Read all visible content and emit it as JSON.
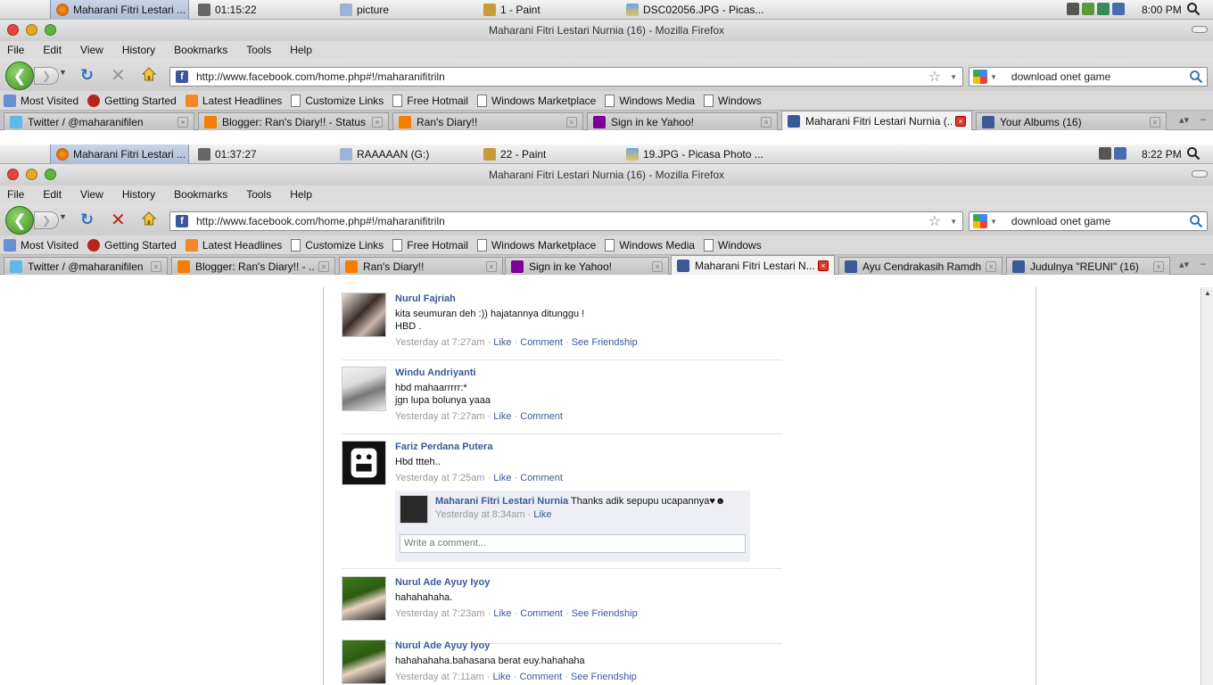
{
  "top": {
    "taskbar": {
      "items": [
        {
          "label": "Maharani Fitri Lestari ...",
          "active": true
        },
        {
          "label": "01:15:22"
        },
        {
          "label": "picture"
        },
        {
          "label": "1 - Paint"
        },
        {
          "label": "DSC02056.JPG - Picas..."
        }
      ],
      "clock": "8:00 PM"
    },
    "title": "Maharani Fitri Lestari Nurnia (16) - Mozilla Firefox",
    "tabs": [
      {
        "label": "Twitter / @maharanifilen"
      },
      {
        "label": "Blogger: Ran's Diary!! - Status ..."
      },
      {
        "label": "Ran's Diary!!"
      },
      {
        "label": "Sign in ke Yahoo!"
      },
      {
        "label": "Maharani Fitri Lestari Nurnia (..."
      },
      {
        "label": "Your Albums (16)"
      }
    ]
  },
  "bottom": {
    "taskbar": {
      "items": [
        {
          "label": "Maharani Fitri Lestari ...",
          "active": true
        },
        {
          "label": "01:37:27"
        },
        {
          "label": "RAAAAAN (G:)"
        },
        {
          "label": "22 - Paint"
        },
        {
          "label": "19.JPG - Picasa Photo ..."
        }
      ],
      "clock": "8:22 PM"
    },
    "title": "Maharani Fitri Lestari Nurnia (16) - Mozilla Firefox",
    "tabs": [
      {
        "label": "Twitter / @maharanifilen"
      },
      {
        "label": "Blogger: Ran's Diary!! - ..."
      },
      {
        "label": "Ran's Diary!!"
      },
      {
        "label": "Sign in ke Yahoo!"
      },
      {
        "label": "Maharani Fitri Lestari N..."
      },
      {
        "label": "Ayu Cendrakasih Ramdh..."
      },
      {
        "label": "Judulnya \"REUNI\" (16)"
      }
    ]
  },
  "menu": [
    "File",
    "Edit",
    "View",
    "History",
    "Bookmarks",
    "Tools",
    "Help"
  ],
  "url": "http://www.facebook.com/home.php#!/maharanifitriln",
  "search": "download onet game",
  "bookmarks": [
    "Most Visited",
    "Getting Started",
    "Latest Headlines",
    "Customize Links",
    "Free Hotmail",
    "Windows Marketplace",
    "Windows Media",
    "Windows"
  ],
  "posts": [
    {
      "name": "Nurul Fajriah",
      "lines": [
        "kita seumuran deh :)) hajatannya ditunggu !",
        "HBD ."
      ],
      "time": "Yesterday at 7:27am",
      "like": "Like",
      "comment": "Comment",
      "friendship": "See Friendship"
    },
    {
      "name": "Windu Andriyanti",
      "lines": [
        "hbd mahaarrrrr:*",
        "jgn lupa bolunya yaaa"
      ],
      "time": "Yesterday at 7:27am",
      "like": "Like",
      "comment": "Comment"
    },
    {
      "name": "Fariz Perdana Putera",
      "lines": [
        "Hbd ttteh.."
      ],
      "time": "Yesterday at 7:25am",
      "like": "Like",
      "comment": "Comment"
    },
    {
      "name": "Nurul Ade Ayuy Iyoy",
      "lines": [
        "hahahahaha."
      ],
      "time": "Yesterday at 7:23am",
      "like": "Like",
      "comment": "Comment",
      "friendship": "See Friendship"
    },
    {
      "name": "Nurul Ade Ayuy Iyoy",
      "lines": [
        "hahahahaha.bahasana berat euy.hahahaha"
      ],
      "time": "Yesterday at 7:11am",
      "like": "Like",
      "comment": "Comment",
      "friendship": "See Friendship"
    }
  ],
  "reply": {
    "name": "Maharani Fitri Lestari Nurnia",
    "text": "Thanks adik sepupu ucapannya♥☻",
    "time": "Yesterday at 8:34am",
    "like": "Like"
  },
  "comment_placeholder": "Write a comment...",
  "colors": {
    "fb_blue": "#3b5998",
    "tab_close_red": "#d63a2a",
    "back_green": "#3e8f22"
  }
}
